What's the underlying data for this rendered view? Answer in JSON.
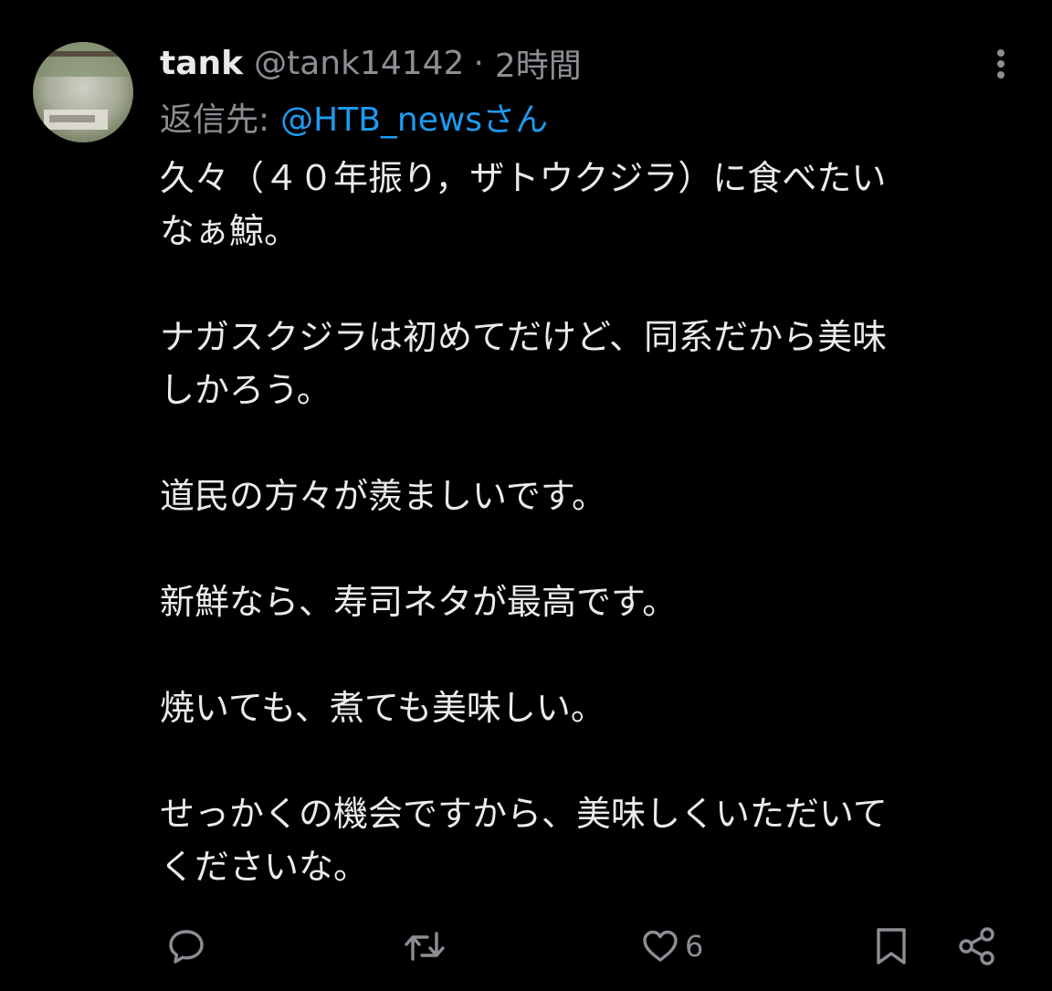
{
  "author": {
    "display_name": "tank",
    "handle": "@tank14142",
    "separator": "·",
    "time": "2時間"
  },
  "reply": {
    "prefix": "返信先:",
    "target": "@HTB_newsさん"
  },
  "body": {
    "paragraphs": [
      "久々（４０年振り，ザトウクジラ）に食べたい\nなぁ鯨。",
      "ナガスクジラは初めてだけど、同系だから美味\nしかろう。",
      "道民の方々が羨ましいです。",
      "新鮮なら、寿司ネタが最高です。",
      "焼いても、煮ても美味しい。",
      "せっかくの機会ですから、美味しくいただいて\nくださいな。"
    ]
  },
  "actions": {
    "like_count": "6"
  },
  "icons": {
    "more": "more-vertical-icon",
    "reply": "comment-icon",
    "retweet": "retweet-icon",
    "like": "heart-icon",
    "bookmark": "bookmark-icon",
    "share": "share-icon"
  },
  "colors": {
    "background": "#000000",
    "text": "#e7e9ea",
    "secondary": "#8b8f94",
    "link": "#1d9bf0"
  }
}
